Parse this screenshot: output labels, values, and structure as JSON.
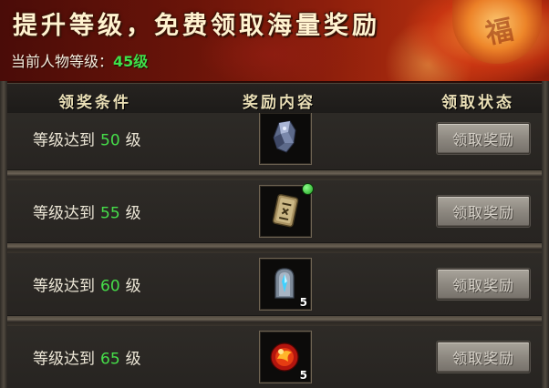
{
  "banner": {
    "title": "提升等级，免费领取海量奖励",
    "level_label": "当前人物等级：",
    "level_value": "45级",
    "lantern_char": "福"
  },
  "columns": {
    "condition": "领奖条件",
    "reward": "奖励内容",
    "status": "领取状态"
  },
  "rows": [
    {
      "prefix": "等级达到",
      "level": "50",
      "suffix": "级",
      "item_icon": "gem-ore-icon",
      "qty": "",
      "button": "领取奖励"
    },
    {
      "prefix": "等级达到",
      "level": "55",
      "suffix": "级",
      "item_icon": "rune-tablet-icon",
      "qty": "",
      "button": "领取奖励"
    },
    {
      "prefix": "等级达到",
      "level": "60",
      "suffix": "级",
      "item_icon": "crystal-stone-icon",
      "qty": "5",
      "button": "领取奖励"
    },
    {
      "prefix": "等级达到",
      "level": "65",
      "suffix": "级",
      "item_icon": "fire-orb-icon",
      "qty": "5",
      "button": "领取奖励"
    }
  ],
  "colors": {
    "level_green": "#46de4a",
    "banner_red": "#8e1f0c",
    "header_gold": "#eadfb6"
  }
}
